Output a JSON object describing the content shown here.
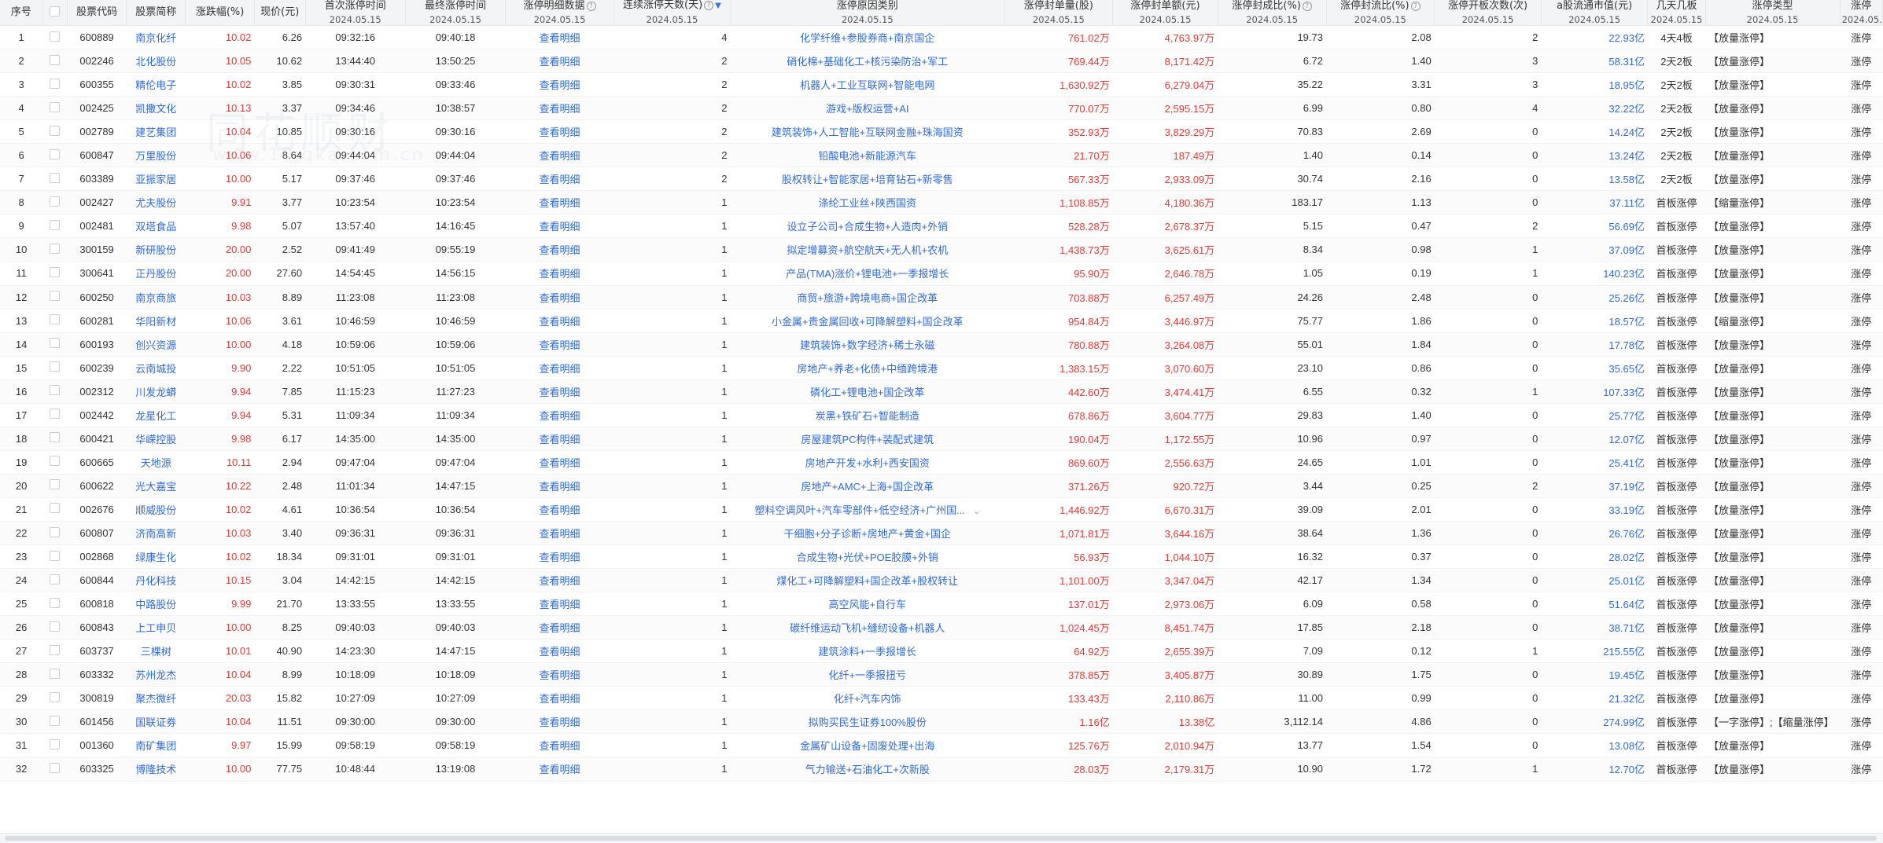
{
  "headers": {
    "seq": "序号",
    "code": "股票代码",
    "name": "股票简称",
    "pct": "涨跌幅(%)",
    "price": "现价(元)",
    "first": "首次涨停时间",
    "last": "最终涨停时间",
    "detail": "涨停明细数据",
    "days": "连续涨停天数(天)",
    "reason": "涨停原因类别",
    "vol": "涨停封单量(股)",
    "amt": "涨停封单额(元)",
    "ratio1": "涨停封成比(%)",
    "ratio2": "涨停封流比(%)",
    "open": "涨停开板次数(次)",
    "mcap": "a股流通市值(元)",
    "board": "几天几板",
    "type": "涨停类型",
    "status": "涨停",
    "date": "2024.05.15"
  },
  "rows": [
    [
      "1",
      "600889",
      "南京化纤",
      "10.02",
      "6.26",
      "09:32:16",
      "09:40:18",
      "查看明细",
      "4",
      "化学纤维+参股券商+南京国企",
      "761.02万",
      "4,763.97万",
      "19.73",
      "2.08",
      "2",
      "22.93亿",
      "4天4板",
      "【放量涨停】",
      "涨停"
    ],
    [
      "2",
      "002246",
      "北化股份",
      "10.05",
      "10.62",
      "13:44:40",
      "13:50:25",
      "查看明细",
      "2",
      "硝化棉+基础化工+核污染防治+军工",
      "769.44万",
      "8,171.42万",
      "6.72",
      "1.40",
      "3",
      "58.31亿",
      "2天2板",
      "【放量涨停】",
      "涨停"
    ],
    [
      "3",
      "600355",
      "精伦电子",
      "10.02",
      "3.85",
      "09:30:31",
      "09:33:46",
      "查看明细",
      "2",
      "机器人+工业互联网+智能电网",
      "1,630.92万",
      "6,279.04万",
      "35.22",
      "3.31",
      "3",
      "18.95亿",
      "2天2板",
      "【放量涨停】",
      "涨停"
    ],
    [
      "4",
      "002425",
      "凯撒文化",
      "10.13",
      "3.37",
      "09:34:46",
      "10:38:57",
      "查看明细",
      "2",
      "游戏+版权运营+AI",
      "770.07万",
      "2,595.15万",
      "6.99",
      "0.80",
      "4",
      "32.22亿",
      "2天2板",
      "【放量涨停】",
      "涨停"
    ],
    [
      "5",
      "002789",
      "建艺集团",
      "10.04",
      "10.85",
      "09:30:16",
      "09:30:16",
      "查看明细",
      "2",
      "建筑装饰+人工智能+互联网金融+珠海国资",
      "352.93万",
      "3,829.29万",
      "70.83",
      "2.69",
      "0",
      "14.24亿",
      "2天2板",
      "【放量涨停】",
      "涨停"
    ],
    [
      "6",
      "600847",
      "万里股份",
      "10.06",
      "8.64",
      "09:44:04",
      "09:44:04",
      "查看明细",
      "2",
      "铅酸电池+新能源汽车",
      "21.70万",
      "187.49万",
      "1.40",
      "0.14",
      "0",
      "13.24亿",
      "2天2板",
      "【放量涨停】",
      "涨停"
    ],
    [
      "7",
      "603389",
      "亚振家居",
      "10.00",
      "5.17",
      "09:37:46",
      "09:37:46",
      "查看明细",
      "2",
      "股权转让+智能家居+培育钻石+新零售",
      "567.33万",
      "2,933.09万",
      "30.74",
      "2.16",
      "0",
      "13.58亿",
      "2天2板",
      "【放量涨停】",
      "涨停"
    ],
    [
      "8",
      "002427",
      "尤夫股份",
      "9.91",
      "3.77",
      "10:23:54",
      "10:23:54",
      "查看明细",
      "1",
      "涤纶工业丝+陕西国资",
      "1,108.85万",
      "4,180.36万",
      "183.17",
      "1.13",
      "0",
      "37.11亿",
      "首板涨停",
      "【缩量涨停】",
      "涨停"
    ],
    [
      "9",
      "002481",
      "双塔食品",
      "9.98",
      "5.07",
      "13:57:40",
      "14:16:45",
      "查看明细",
      "1",
      "设立子公司+合成生物+人造肉+外销",
      "528.28万",
      "2,678.37万",
      "5.15",
      "0.47",
      "2",
      "56.69亿",
      "首板涨停",
      "【放量涨停】",
      "涨停"
    ],
    [
      "10",
      "300159",
      "新研股份",
      "20.00",
      "2.52",
      "09:41:49",
      "09:55:19",
      "查看明细",
      "1",
      "拟定增募资+航空航天+无人机+农机",
      "1,438.73万",
      "3,625.61万",
      "8.34",
      "0.98",
      "1",
      "37.09亿",
      "首板涨停",
      "【放量涨停】",
      "涨停"
    ],
    [
      "11",
      "300641",
      "正丹股份",
      "20.00",
      "27.60",
      "14:54:45",
      "14:56:15",
      "查看明细",
      "1",
      "产品(TMA)涨价+锂电池+一季报增长",
      "95.90万",
      "2,646.78万",
      "1.05",
      "0.19",
      "1",
      "140.23亿",
      "首板涨停",
      "【放量涨停】",
      "涨停"
    ],
    [
      "12",
      "600250",
      "南京商旅",
      "10.03",
      "8.89",
      "11:23:08",
      "11:23:08",
      "查看明细",
      "1",
      "商贸+旅游+跨境电商+国企改革",
      "703.88万",
      "6,257.49万",
      "24.26",
      "2.48",
      "0",
      "25.26亿",
      "首板涨停",
      "【放量涨停】",
      "涨停"
    ],
    [
      "13",
      "600281",
      "华阳新材",
      "10.06",
      "3.61",
      "10:46:59",
      "10:46:59",
      "查看明细",
      "1",
      "小金属+贵金属回收+可降解塑料+国企改革",
      "954.84万",
      "3,446.97万",
      "75.77",
      "1.86",
      "0",
      "18.57亿",
      "首板涨停",
      "【缩量涨停】",
      "涨停"
    ],
    [
      "14",
      "600193",
      "创兴资源",
      "10.00",
      "4.18",
      "10:59:06",
      "10:59:06",
      "查看明细",
      "1",
      "建筑装饰+数字经济+稀土永磁",
      "780.88万",
      "3,264.08万",
      "55.01",
      "1.84",
      "0",
      "17.78亿",
      "首板涨停",
      "【放量涨停】",
      "涨停"
    ],
    [
      "15",
      "600239",
      "云南城投",
      "9.90",
      "2.22",
      "10:51:05",
      "10:51:05",
      "查看明细",
      "1",
      "房地产+养老+化债+中缅跨境港",
      "1,383.15万",
      "3,070.60万",
      "23.10",
      "0.86",
      "0",
      "35.65亿",
      "首板涨停",
      "【放量涨停】",
      "涨停"
    ],
    [
      "16",
      "002312",
      "川发龙蟒",
      "9.94",
      "7.85",
      "11:15:23",
      "11:27:23",
      "查看明细",
      "1",
      "磷化工+锂电池+国企改革",
      "442.60万",
      "3,474.41万",
      "6.55",
      "0.32",
      "1",
      "107.33亿",
      "首板涨停",
      "【放量涨停】",
      "涨停"
    ],
    [
      "17",
      "002442",
      "龙星化工",
      "9.94",
      "5.31",
      "11:09:34",
      "11:09:34",
      "查看明细",
      "1",
      "炭黑+铁矿石+智能制造",
      "678.86万",
      "3,604.77万",
      "29.83",
      "1.40",
      "0",
      "25.77亿",
      "首板涨停",
      "【放量涨停】",
      "涨停"
    ],
    [
      "18",
      "600421",
      "华嵘控股",
      "9.98",
      "6.17",
      "14:35:00",
      "14:35:00",
      "查看明细",
      "1",
      "房屋建筑PC构件+装配式建筑",
      "190.04万",
      "1,172.55万",
      "10.96",
      "0.97",
      "0",
      "12.07亿",
      "首板涨停",
      "【放量涨停】",
      "涨停"
    ],
    [
      "19",
      "600665",
      "天地源",
      "10.11",
      "2.94",
      "09:47:04",
      "09:47:04",
      "查看明细",
      "1",
      "房地产开发+水利+西安国资",
      "869.60万",
      "2,556.63万",
      "24.65",
      "1.01",
      "0",
      "25.41亿",
      "首板涨停",
      "【放量涨停】",
      "涨停"
    ],
    [
      "20",
      "600622",
      "光大嘉宝",
      "10.22",
      "2.48",
      "11:01:34",
      "14:47:15",
      "查看明细",
      "1",
      "房地产+AMC+上海+国企改革",
      "371.26万",
      "920.72万",
      "3.44",
      "0.25",
      "2",
      "37.19亿",
      "首板涨停",
      "【放量涨停】",
      "涨停"
    ],
    [
      "21",
      "002676",
      "顺威股份",
      "10.02",
      "4.61",
      "10:36:54",
      "10:36:54",
      "查看明细",
      "1",
      "塑料空调风叶+汽车零部件+低空经济+广州国...",
      "1,446.92万",
      "6,670.31万",
      "39.09",
      "2.01",
      "0",
      "33.19亿",
      "首板涨停",
      "【放量涨停】",
      "涨停"
    ],
    [
      "22",
      "600807",
      "济南高新",
      "10.03",
      "3.40",
      "09:36:31",
      "09:36:31",
      "查看明细",
      "1",
      "干细胞+分子诊断+房地产+黄金+国企",
      "1,071.81万",
      "3,644.16万",
      "38.64",
      "1.36",
      "0",
      "26.76亿",
      "首板涨停",
      "【放量涨停】",
      "涨停"
    ],
    [
      "23",
      "002868",
      "绿康生化",
      "10.02",
      "18.34",
      "09:31:01",
      "09:31:01",
      "查看明细",
      "1",
      "合成生物+光伏+POE胶膜+外销",
      "56.93万",
      "1,044.10万",
      "16.32",
      "0.37",
      "0",
      "28.02亿",
      "首板涨停",
      "【放量涨停】",
      "涨停"
    ],
    [
      "24",
      "600844",
      "丹化科技",
      "10.15",
      "3.04",
      "14:42:15",
      "14:42:15",
      "查看明细",
      "1",
      "煤化工+可降解塑料+国企改革+股权转让",
      "1,101.00万",
      "3,347.04万",
      "42.17",
      "1.34",
      "0",
      "25.01亿",
      "首板涨停",
      "【放量涨停】",
      "涨停"
    ],
    [
      "25",
      "600818",
      "中路股份",
      "9.99",
      "21.70",
      "13:33:55",
      "13:33:55",
      "查看明细",
      "1",
      "高空风能+自行车",
      "137.01万",
      "2,973.06万",
      "6.09",
      "0.58",
      "0",
      "51.64亿",
      "首板涨停",
      "【放量涨停】",
      "涨停"
    ],
    [
      "26",
      "600843",
      "上工申贝",
      "10.00",
      "8.25",
      "09:40:03",
      "09:40:03",
      "查看明细",
      "1",
      "碳纤维运动飞机+缝纫设备+机器人",
      "1,024.45万",
      "8,451.74万",
      "17.85",
      "2.18",
      "0",
      "38.71亿",
      "首板涨停",
      "【放量涨停】",
      "涨停"
    ],
    [
      "27",
      "603737",
      "三棵树",
      "10.01",
      "40.90",
      "14:23:30",
      "14:47:15",
      "查看明细",
      "1",
      "建筑涂料+一季报增长",
      "64.92万",
      "2,655.39万",
      "7.09",
      "0.12",
      "1",
      "215.55亿",
      "首板涨停",
      "【放量涨停】",
      "涨停"
    ],
    [
      "28",
      "603332",
      "苏州龙杰",
      "10.04",
      "8.99",
      "10:18:09",
      "10:18:09",
      "查看明细",
      "1",
      "化纤+一季报扭亏",
      "378.85万",
      "3,405.87万",
      "30.89",
      "1.75",
      "0",
      "19.45亿",
      "首板涨停",
      "【放量涨停】",
      "涨停"
    ],
    [
      "29",
      "300819",
      "聚杰微纤",
      "20.03",
      "15.82",
      "10:27:09",
      "10:27:09",
      "查看明细",
      "1",
      "化纤+汽车内饰",
      "133.43万",
      "2,110.86万",
      "11.00",
      "0.99",
      "0",
      "21.32亿",
      "首板涨停",
      "【放量涨停】",
      "涨停"
    ],
    [
      "30",
      "601456",
      "国联证券",
      "10.04",
      "11.51",
      "09:30:00",
      "09:30:00",
      "查看明细",
      "1",
      "拟购买民生证券100%股份",
      "1.16亿",
      "13.38亿",
      "3,112.14",
      "4.86",
      "0",
      "274.99亿",
      "首板涨停",
      "【一字涨停】;【缩量涨停】",
      "涨停"
    ],
    [
      "31",
      "001360",
      "南矿集团",
      "9.97",
      "15.99",
      "09:58:19",
      "09:58:19",
      "查看明细",
      "1",
      "金属矿山设备+固废处理+出海",
      "125.76万",
      "2,010.94万",
      "13.77",
      "1.54",
      "0",
      "13.08亿",
      "首板涨停",
      "【放量涨停】",
      "涨停"
    ],
    [
      "32",
      "603325",
      "博隆技术",
      "10.00",
      "77.75",
      "10:48:44",
      "13:19:08",
      "查看明细",
      "1",
      "气力输送+石油化工+次新股",
      "28.03万",
      "2,179.31万",
      "10.90",
      "1.72",
      "1",
      "12.70亿",
      "首板涨停",
      "【放量涨停】",
      "涨停"
    ]
  ],
  "watermark": {
    "main": "同花顺财",
    "sub": "www.10jqka.com.cn"
  }
}
